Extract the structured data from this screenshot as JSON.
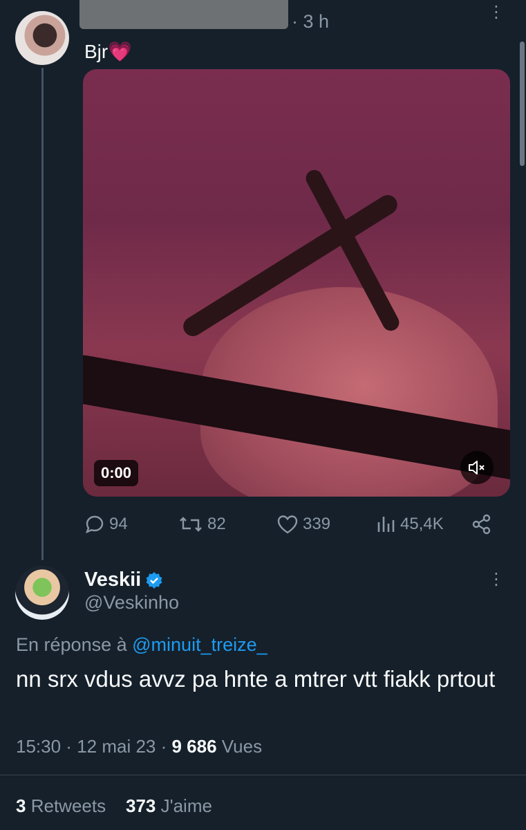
{
  "first_tweet": {
    "timestamp": "3 h",
    "text": "Bjr💗",
    "video": {
      "time": "0:00"
    },
    "actions": {
      "replies": "94",
      "retweets": "82",
      "likes": "339",
      "views": "45,4K"
    }
  },
  "reply_tweet": {
    "display_name": "Veskii",
    "handle": "@Veskinho",
    "reply_prefix": "En réponse à",
    "reply_target": "@minuit_treize_",
    "text": "nn srx vdus avvz pa hnte a mtrer vtt fiakk prtout",
    "time": "15:30",
    "date": "12 mai 23",
    "views_count": "9 686",
    "views_label": "Vues",
    "retweets_count": "3",
    "retweets_label": "Retweets",
    "likes_count": "373",
    "likes_label": "J'aime"
  },
  "colors": {
    "background": "#15202b",
    "muted": "#8b98a5",
    "link": "#1d9bf0",
    "verified": "#1d9bf0"
  },
  "icons": [
    "more-vert-icon",
    "reply-icon",
    "retweet-icon",
    "like-icon",
    "views-icon",
    "share-icon",
    "mute-icon",
    "verified-icon"
  ]
}
